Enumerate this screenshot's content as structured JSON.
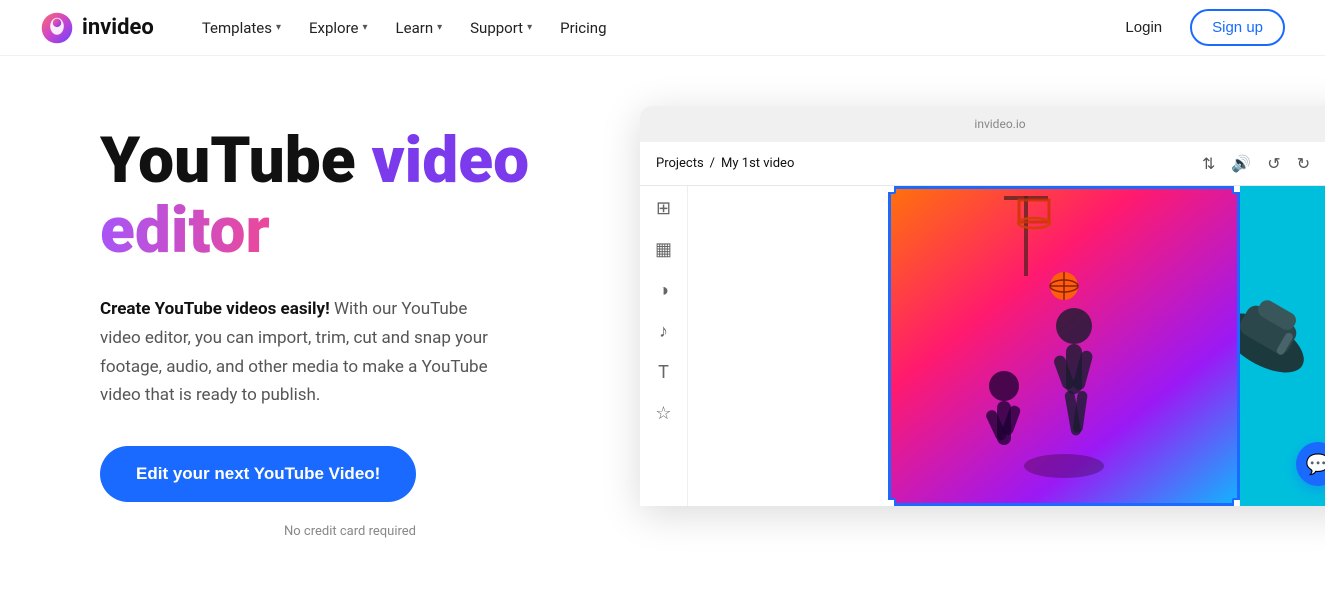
{
  "brand": {
    "name": "invideo",
    "logo_alt": "InVideo logo"
  },
  "nav": {
    "links": [
      {
        "label": "Templates",
        "has_dropdown": true
      },
      {
        "label": "Explore",
        "has_dropdown": true
      },
      {
        "label": "Learn",
        "has_dropdown": true
      },
      {
        "label": "Support",
        "has_dropdown": true
      },
      {
        "label": "Pricing",
        "has_dropdown": false
      }
    ],
    "login_label": "Login",
    "signup_label": "Sign up"
  },
  "hero": {
    "title_part1": "YouTube ",
    "title_video": "video",
    "title_space": " ",
    "title_editor": "editor",
    "description_bold": "Create YouTube videos easily!",
    "description_rest": " With our YouTube video editor, you can import, trim, cut and snap your footage, audio, and other media to make a YouTube video that is ready to publish.",
    "cta_label": "Edit your next YouTube Video!",
    "cta_note": "No credit card required"
  },
  "editor": {
    "url": "invideo.io",
    "breadcrumb_projects": "Projects",
    "breadcrumb_separator": "/",
    "breadcrumb_current": "My 1st video",
    "toolbar_icons": [
      "⇅",
      "🔊",
      "↺",
      "↻",
      "⬤"
    ],
    "sidebar_icons": [
      "⊞",
      "▦",
      "◑",
      "♪",
      "T",
      "☆"
    ]
  }
}
